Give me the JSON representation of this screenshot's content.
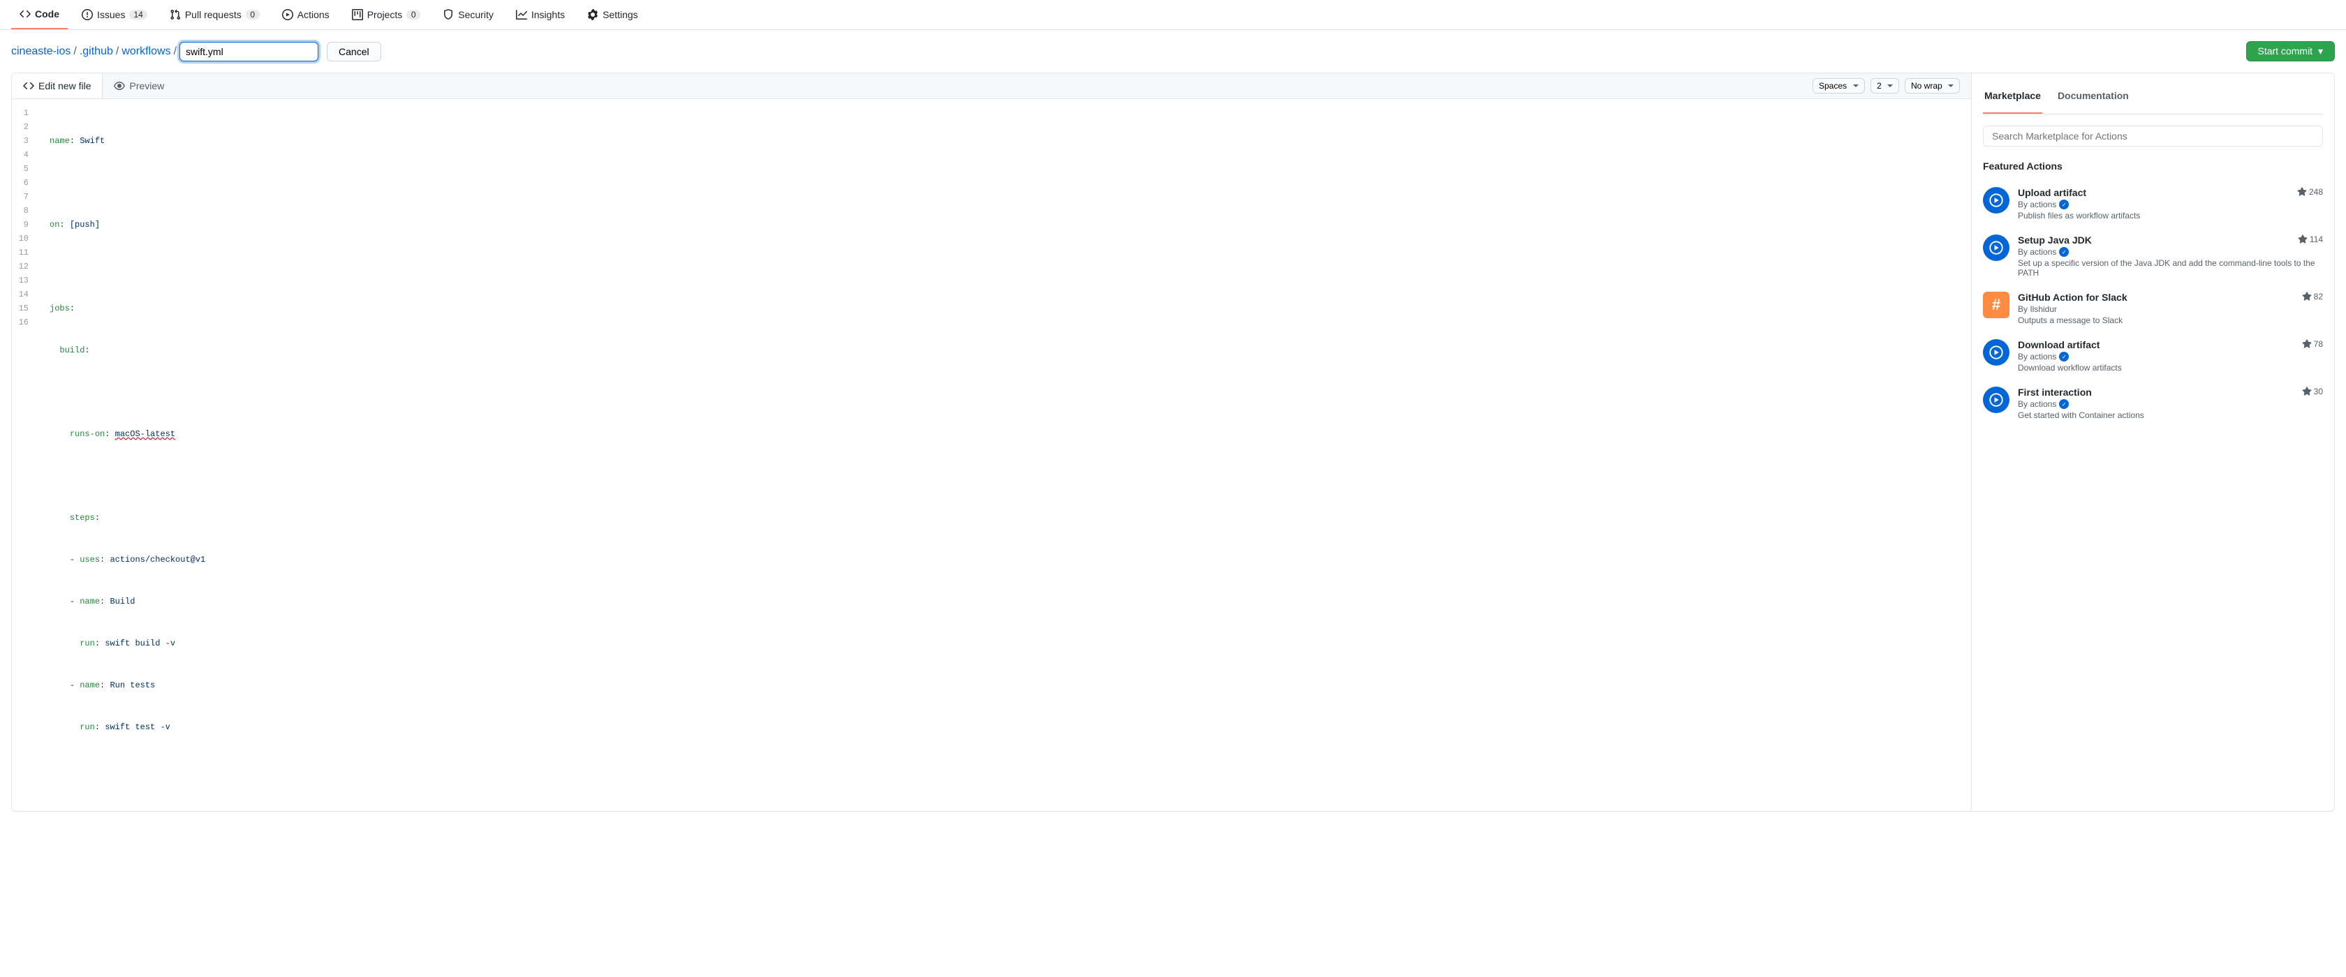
{
  "repo_nav": {
    "code": "Code",
    "issues": "Issues",
    "issues_count": "14",
    "pull_requests": "Pull requests",
    "pull_requests_count": "0",
    "actions": "Actions",
    "projects": "Projects",
    "projects_count": "0",
    "security": "Security",
    "insights": "Insights",
    "settings": "Settings"
  },
  "breadcrumb": {
    "repo": "cineaste-ios",
    "path1": ".github",
    "path2": "workflows",
    "filename_value": "swift.yml",
    "cancel": "Cancel"
  },
  "commit_button": "Start commit",
  "editor_tabs": {
    "edit": "Edit new file",
    "preview": "Preview"
  },
  "editor_controls": {
    "indent_mode": "Spaces",
    "indent_size": "2",
    "wrap_mode": "No wrap"
  },
  "code": {
    "lines": [
      "1",
      "2",
      "3",
      "4",
      "5",
      "6",
      "7",
      "8",
      "9",
      "10",
      "11",
      "12",
      "13",
      "14",
      "15",
      "16"
    ],
    "l1_key": "name",
    "l1_val": "Swift",
    "l3_key": "on",
    "l3_val": "[push]",
    "l5_key": "jobs",
    "l6_key": "build",
    "l8_key": "runs-on",
    "l8_val": "macOS-latest",
    "l10_key": "steps",
    "l11_key": "uses",
    "l11_val": "actions/checkout@v1",
    "l12_key": "name",
    "l12_val": "Build",
    "l13_key": "run",
    "l13_val": "swift build -v",
    "l14_key": "name",
    "l14_val": "Run tests",
    "l15_key": "run",
    "l15_val": "swift test -v"
  },
  "sidebar": {
    "tab_marketplace": "Marketplace",
    "tab_documentation": "Documentation",
    "search_placeholder": "Search Marketplace for Actions",
    "featured_title": "Featured Actions",
    "actions": [
      {
        "title": "Upload artifact",
        "by_prefix": "By ",
        "by": "actions",
        "verified": true,
        "desc": "Publish files as workflow artifacts",
        "stars": "248",
        "icon_variant": "blue"
      },
      {
        "title": "Setup Java JDK",
        "by_prefix": "By ",
        "by": "actions",
        "verified": true,
        "desc": "Set up a specific version of the Java JDK and add the command-line tools to the PATH",
        "stars": "114",
        "icon_variant": "blue"
      },
      {
        "title": "GitHub Action for Slack",
        "by_prefix": "By ",
        "by": "Ilshidur",
        "verified": false,
        "desc": "Outputs a message to Slack",
        "stars": "82",
        "icon_variant": "orange"
      },
      {
        "title": "Download artifact",
        "by_prefix": "By ",
        "by": "actions",
        "verified": true,
        "desc": "Download workflow artifacts",
        "stars": "78",
        "icon_variant": "blue"
      },
      {
        "title": "First interaction",
        "by_prefix": "By ",
        "by": "actions",
        "verified": true,
        "desc": "Get started with Container actions",
        "stars": "30",
        "icon_variant": "blue"
      }
    ]
  }
}
